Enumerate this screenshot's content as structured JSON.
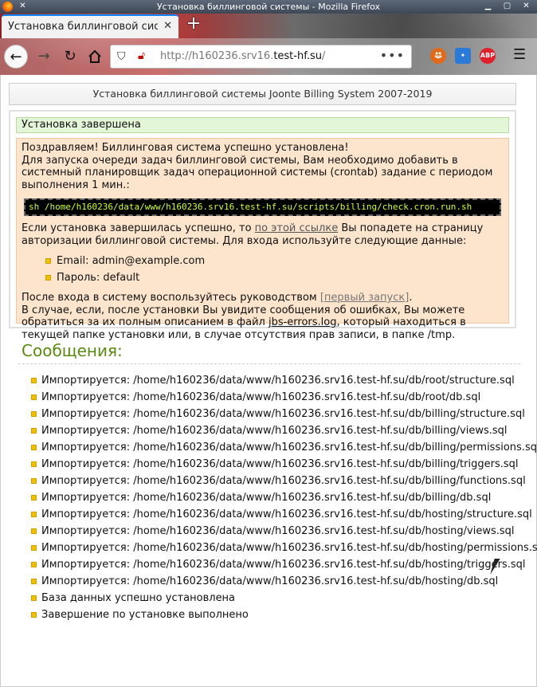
{
  "window": {
    "title": "Установка биллинговой системы - Mozilla Firefox"
  },
  "tab": {
    "label": "Установка биллинговой сист",
    "close": "✕",
    "newtab": "+"
  },
  "navbar": {
    "url_prefix": "http://h160236.srv16.",
    "url_domain": "test-hf.su",
    "url_suffix": "/",
    "dots": "•••",
    "ext_abp": "ABP"
  },
  "page": {
    "header": "Установка биллинговой системы Joonte Billing System 2007-2019",
    "done": "Установка завершена",
    "para1_line1": "Поздравляем! Биллинговая система успешно установлена!",
    "para1_line2": "Для запуска очереди задач биллинговой системы, Вам необходимо добавить в системный планировщик задач операционной системы (crontab) задание с периодом выполнения 1 мин.:",
    "command": "sh /home/h160236/data/www/h160236.srv16.test-hf.su/scripts/billing/check.cron.run.sh",
    "para2_before": "Если установка завершилась успешно, то ",
    "para2_link": "по этой ссылке",
    "para2_after": " Вы попадете на страницу авторизации биллинговой системы. Для входа используйте следующие данные:",
    "email": "Email: admin@example.com",
    "password": "Пароль: default",
    "para3_before": "После входа в систему воспользуйтесь руководством ",
    "para3_link": "[первый запуск]",
    "para3_after": ".",
    "para4_before": "В случае, если, после установки Вы увидите сообщения об ошибках, Вы можете обратиться за их полным описанием в файл ",
    "para4_link": "jbs-errors.log",
    "para4_after": ", который находиться в текущей папке установки или, в случае отсутствия прав записи, в папке /tmp."
  },
  "messages": {
    "title": "Сообщения:",
    "items": [
      "Импортируется: /home/h160236/data/www/h160236.srv16.test-hf.su/db/root/structure.sql",
      "Импортируется: /home/h160236/data/www/h160236.srv16.test-hf.su/db/root/db.sql",
      "Импортируется: /home/h160236/data/www/h160236.srv16.test-hf.su/db/billing/structure.sql",
      "Импортируется: /home/h160236/data/www/h160236.srv16.test-hf.su/db/billing/views.sql",
      "Импортируется: /home/h160236/data/www/h160236.srv16.test-hf.su/db/billing/permissions.sql",
      "Импортируется: /home/h160236/data/www/h160236.srv16.test-hf.su/db/billing/triggers.sql",
      "Импортируется: /home/h160236/data/www/h160236.srv16.test-hf.su/db/billing/functions.sql",
      "Импортируется: /home/h160236/data/www/h160236.srv16.test-hf.su/db/billing/db.sql",
      "Импортируется: /home/h160236/data/www/h160236.srv16.test-hf.su/db/hosting/structure.sql",
      "Импортируется: /home/h160236/data/www/h160236.srv16.test-hf.su/db/hosting/views.sql",
      "Импортируется: /home/h160236/data/www/h160236.srv16.test-hf.su/db/hosting/permissions.sql",
      "Импортируется: /home/h160236/data/www/h160236.srv16.test-hf.su/db/hosting/triggers.sql",
      "Импортируется: /home/h160236/data/www/h160236.srv16.test-hf.su/db/hosting/db.sql",
      "База данных успешно установлена",
      "Завершение по установке выполнено"
    ]
  },
  "colors": {
    "accent": "#0a84ff",
    "success_bg": "#e4f6d8",
    "info_bg": "#fde4cc",
    "title_green": "#5a8a10",
    "bullet": "#f0c000"
  }
}
